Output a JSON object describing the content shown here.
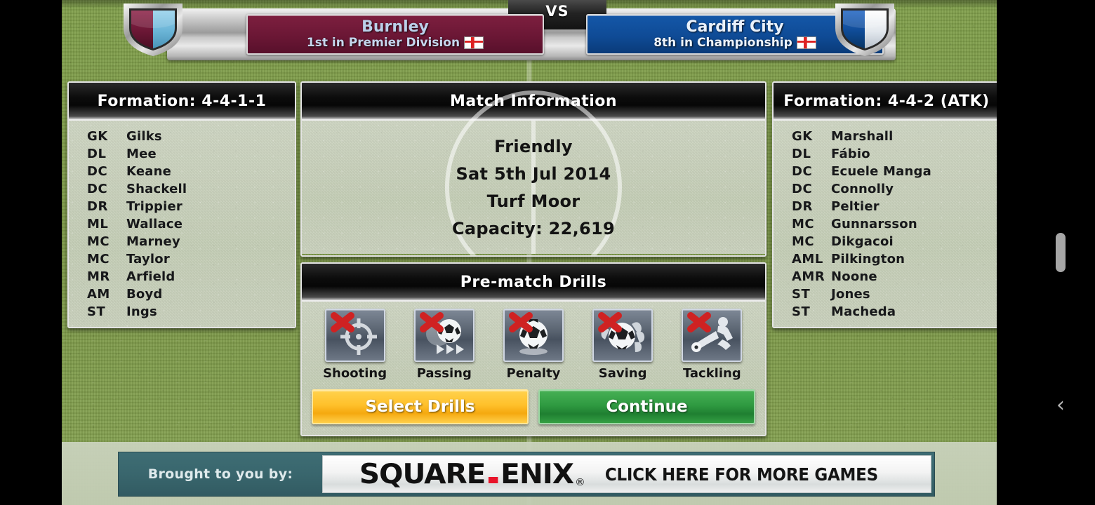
{
  "header": {
    "vs_label": "VS",
    "home": {
      "name": "Burnley",
      "standing": "1st in Premier Division",
      "flag": "england-flag",
      "crest": "burnley-crest",
      "primary_color": "#6b1735",
      "secondary_color": "#77bcdc"
    },
    "away": {
      "name": "Cardiff City",
      "standing": "8th in Championship",
      "flag": "england-flag",
      "crest": "cardiff-city-crest",
      "primary_color": "#0f4b96",
      "secondary_color": "#eef2f7"
    }
  },
  "home_squad": {
    "title": "Formation: 4-4-1-1",
    "players": [
      {
        "pos": "GK",
        "name": "Gilks"
      },
      {
        "pos": "DL",
        "name": "Mee"
      },
      {
        "pos": "DC",
        "name": "Keane"
      },
      {
        "pos": "DC",
        "name": "Shackell"
      },
      {
        "pos": "DR",
        "name": "Trippier"
      },
      {
        "pos": "ML",
        "name": "Wallace"
      },
      {
        "pos": "MC",
        "name": "Marney"
      },
      {
        "pos": "MC",
        "name": "Taylor"
      },
      {
        "pos": "MR",
        "name": "Arfield"
      },
      {
        "pos": "AM",
        "name": "Boyd"
      },
      {
        "pos": "ST",
        "name": "Ings"
      }
    ]
  },
  "away_squad": {
    "title": "Formation: 4-4-2 (ATK)",
    "players": [
      {
        "pos": "GK",
        "name": "Marshall"
      },
      {
        "pos": "DL",
        "name": "Fábio"
      },
      {
        "pos": "DC",
        "name": "Ecuele Manga"
      },
      {
        "pos": "DC",
        "name": "Connolly"
      },
      {
        "pos": "DR",
        "name": "Peltier"
      },
      {
        "pos": "MC",
        "name": "Gunnarsson"
      },
      {
        "pos": "MC",
        "name": "Dikgacoi"
      },
      {
        "pos": "AML",
        "name": "Pilkington"
      },
      {
        "pos": "AMR",
        "name": "Noone"
      },
      {
        "pos": "ST",
        "name": "Jones"
      },
      {
        "pos": "ST",
        "name": "Macheda"
      }
    ]
  },
  "match_info": {
    "title": "Match Information",
    "competition": "Friendly",
    "date": "Sat 5th Jul 2014",
    "venue": "Turf Moor",
    "capacity": "Capacity: 22,619"
  },
  "drills": {
    "title": "Pre-match Drills",
    "items": [
      {
        "label": "Shooting",
        "icon": "target-crosshair-icon",
        "selected": false,
        "status_icon": "red-x-icon"
      },
      {
        "label": "Passing",
        "icon": "ball-with-arrows-icon",
        "selected": false,
        "status_icon": "red-x-icon"
      },
      {
        "label": "Penalty",
        "icon": "ball-on-spot-icon",
        "selected": false,
        "status_icon": "red-x-icon"
      },
      {
        "label": "Saving",
        "icon": "ball-in-gloves-icon",
        "selected": false,
        "status_icon": "red-x-icon"
      },
      {
        "label": "Tackling",
        "icon": "sliding-tackle-icon",
        "selected": false,
        "status_icon": "red-x-icon"
      }
    ],
    "select_button": "Select Drills",
    "continue_button": "Continue"
  },
  "ad": {
    "brought_by": "Brought to you by:",
    "logo_square": "SQUARE",
    "logo_enix": "ENIX",
    "logo_trademark": "®",
    "cta": "CLICK HERE FOR MORE GAMES"
  },
  "chrome": {
    "back_chevron": "‹"
  },
  "colors": {
    "grass": "#7d9a48",
    "panel_body": "#c6cfb9",
    "select_drills": "#ffc02a",
    "continue": "#2f9a41",
    "ad_background": "#39666d"
  }
}
